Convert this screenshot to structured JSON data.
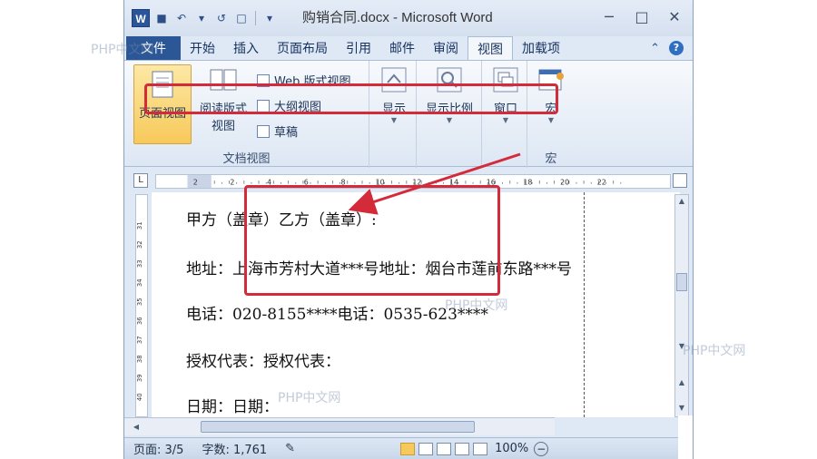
{
  "window": {
    "title": "购销合同.docx - Microsoft Word",
    "app_icon_label": "W"
  },
  "qat": {
    "save_glyph": "■",
    "undo_glyph": "↶",
    "redo_glyph": "↺",
    "new_glyph": "□",
    "more_glyph": "▾"
  },
  "window_controls": {
    "minimize_glyph": "─",
    "maximize_glyph": "□",
    "close_glyph": "✕"
  },
  "tabs": [
    "文件",
    "开始",
    "插入",
    "页面布局",
    "引用",
    "邮件",
    "审阅",
    "视图",
    "加载项"
  ],
  "active_tab": "视图",
  "ribbon": {
    "doc_views": {
      "group_label": "文档视图",
      "print_layout": "页面视图",
      "reading_line1": "阅读版式",
      "reading_line2": "视图",
      "web": "Web 版式视图",
      "outline": "大纲视图",
      "draft": "草稿"
    },
    "show": {
      "label": "显示"
    },
    "zoom": {
      "label": "显示比例"
    },
    "window": {
      "label": "窗口"
    },
    "macros": {
      "button": "宏",
      "group_label": "宏"
    }
  },
  "ruler": {
    "tab_selector": "L",
    "h_labels": [
      "2",
      "2",
      "4",
      "6",
      "8",
      "10",
      "12",
      "14",
      "16",
      "18",
      "20",
      "22"
    ],
    "v_labels": [
      "31",
      "32",
      "33",
      "34",
      "35",
      "36",
      "37",
      "38",
      "39",
      "40"
    ]
  },
  "document": {
    "paragraphs": [
      "甲方（盖章）乙方（盖章）:",
      "地址：上海市芳村大道***号地址：烟台市莲前东路***号",
      "电话：020-8155****电话：0535-623****",
      "授权代表：授权代表：",
      "日期：日期："
    ]
  },
  "status_bar": {
    "page": "页面: 3/5",
    "words": "字数: 1,761",
    "zoom": "100%",
    "zoom_minus": "−"
  },
  "watermarks": [
    "PHP中文网",
    "PHP中文网",
    "PHP中文网",
    "PHP中文网"
  ],
  "colors": {
    "highlight_red": "#d42b3a",
    "file_tab": "#2b5797",
    "selected_button": "#f7c95a"
  }
}
